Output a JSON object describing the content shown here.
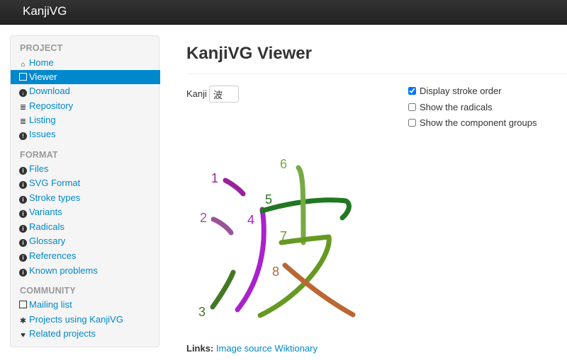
{
  "brand": "KanjiVG",
  "sidebar": {
    "sections": [
      {
        "header": "PROJECT",
        "items": [
          {
            "label": "Home",
            "icon": "home-icon"
          },
          {
            "label": "Viewer",
            "icon": "picture-icon",
            "active": true
          },
          {
            "label": "Download",
            "icon": "download-icon"
          },
          {
            "label": "Repository",
            "icon": "list-icon"
          },
          {
            "label": "Listing",
            "icon": "list-icon"
          },
          {
            "label": "Issues",
            "icon": "exclamation-icon"
          }
        ]
      },
      {
        "header": "FORMAT",
        "items": [
          {
            "label": "Files",
            "icon": "info-icon"
          },
          {
            "label": "SVG Format",
            "icon": "info-icon"
          },
          {
            "label": "Stroke types",
            "icon": "info-icon"
          },
          {
            "label": "Variants",
            "icon": "info-icon"
          },
          {
            "label": "Radicals",
            "icon": "info-icon"
          },
          {
            "label": "Glossary",
            "icon": "info-icon"
          },
          {
            "label": "References",
            "icon": "info-icon"
          },
          {
            "label": "Known problems",
            "icon": "info-icon"
          }
        ]
      },
      {
        "header": "COMMUNITY",
        "items": [
          {
            "label": "Mailing list",
            "icon": "book-icon"
          },
          {
            "label": "Projects using KanjiVG",
            "icon": "asterisk-icon"
          },
          {
            "label": "Related projects",
            "icon": "heart-icon"
          }
        ]
      }
    ]
  },
  "main": {
    "title": "KanjiVG Viewer",
    "kanji_label": "Kanji",
    "kanji_value": "波",
    "options": [
      {
        "label": "Display stroke order",
        "checked": true
      },
      {
        "label": "Show the radicals",
        "checked": false
      },
      {
        "label": "Show the component groups",
        "checked": false
      }
    ],
    "strokes": [
      {
        "num": "1",
        "color": "#992299"
      },
      {
        "num": "2",
        "color": "#995599"
      },
      {
        "num": "3",
        "color": "#447722"
      },
      {
        "num": "4",
        "color": "#aa22cc"
      },
      {
        "num": "5",
        "color": "#227722"
      },
      {
        "num": "6",
        "color": "#77aa44"
      },
      {
        "num": "7",
        "color": "#669922"
      },
      {
        "num": "8",
        "color": "#bb6633"
      }
    ],
    "links_label": "Links:",
    "links": [
      "Image source",
      "Wiktionary"
    ]
  }
}
